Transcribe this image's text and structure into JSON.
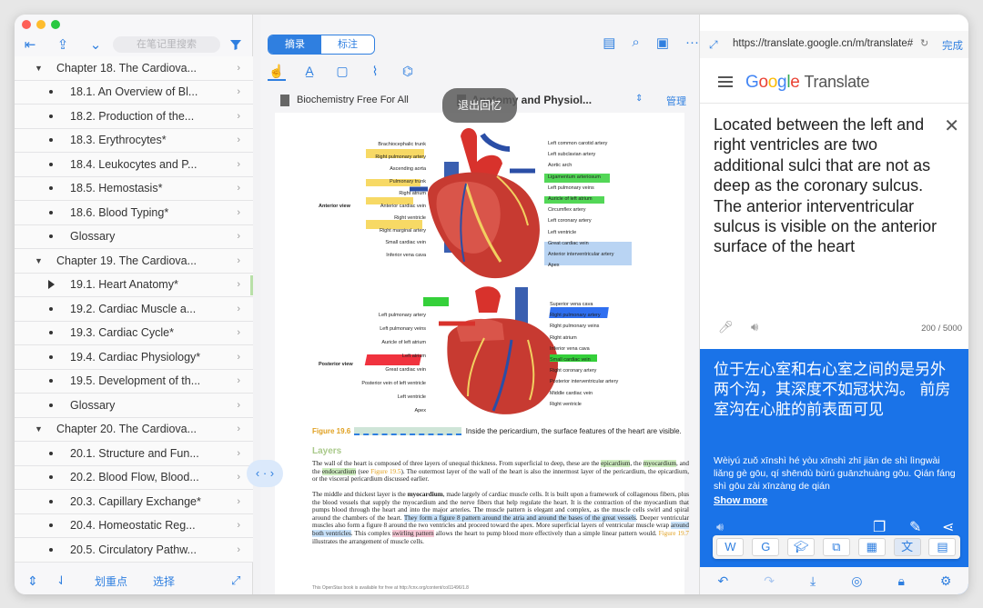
{
  "window": {
    "traffic_colors": [
      "#fe5f57",
      "#febc2e",
      "#28c840"
    ]
  },
  "left_panel": {
    "note_search_placeholder": "在笔记里搜索",
    "toc": [
      {
        "kind": "chapter",
        "label": "Chapter 18. The Cardiova..."
      },
      {
        "kind": "section",
        "label": "18.1. An Overview of Bl..."
      },
      {
        "kind": "section",
        "label": "18.2. Production of the..."
      },
      {
        "kind": "section",
        "label": "18.3. Erythrocytes*"
      },
      {
        "kind": "section",
        "label": "18.4. Leukocytes and P..."
      },
      {
        "kind": "section",
        "label": "18.5. Hemostasis*"
      },
      {
        "kind": "section",
        "label": "18.6. Blood Typing*"
      },
      {
        "kind": "section",
        "label": "Glossary"
      },
      {
        "kind": "chapter",
        "label": "Chapter 19. The Cardiova..."
      },
      {
        "kind": "current",
        "label": "19.1. Heart Anatomy*"
      },
      {
        "kind": "section",
        "label": "19.2. Cardiac Muscle a..."
      },
      {
        "kind": "section",
        "label": "19.3. Cardiac Cycle*"
      },
      {
        "kind": "section",
        "label": "19.4. Cardiac Physiology*"
      },
      {
        "kind": "section",
        "label": "19.5. Development of th..."
      },
      {
        "kind": "section",
        "label": "Glossary"
      },
      {
        "kind": "chapter",
        "label": "Chapter 20. The Cardiova..."
      },
      {
        "kind": "section",
        "label": "20.1. Structure and Fun..."
      },
      {
        "kind": "section",
        "label": "20.2. Blood Flow, Blood..."
      },
      {
        "kind": "section",
        "label": "20.3. Capillary Exchange*"
      },
      {
        "kind": "section",
        "label": "20.4. Homeostatic Reg..."
      },
      {
        "kind": "section",
        "label": "20.5. Circulatory Pathw..."
      }
    ],
    "bottom": {
      "highlight_label": "划重点",
      "select_label": "选择"
    }
  },
  "middle_panel": {
    "tabs": {
      "excerpt": "摘录",
      "annotate": "标注"
    },
    "doc_left": "Biochemistry Free For All",
    "doc_right": "Anatomy and Physiol...",
    "manage": "管理",
    "tooltip": "退出回忆",
    "figure": {
      "anterior_title": "Anterior view",
      "posterior_title": "Posterior view",
      "anterior_left": [
        "Brachiocephalic trunk",
        "Right pulmonary artery",
        "Ascending aorta",
        "Pulmonary trunk",
        "Right atrium",
        "Anterior cardiac vein",
        "Right ventricle",
        "Right marginal artery",
        "Small cardiac vein",
        "Inferior vena cava"
      ],
      "anterior_right": [
        "Left common carotid artery",
        "Left subclavian artery",
        "Aortic arch",
        "Ligamentum arteriosum",
        "Left pulmonary veins",
        "Auricle of left atrium",
        "Circumflex artery",
        "Left coronary artery",
        "Left ventricle",
        "Great cardiac vein",
        "Anterior interventricular artery",
        "Apex"
      ],
      "posterior_left": [
        "Left pulmonary artery",
        "Left pulmonary veins",
        "Auricle of left atrium",
        "Left atrium",
        "Great cardiac vein",
        "Posterior vein of left ventricle",
        "Left ventricle",
        "Apex"
      ],
      "posterior_right": [
        "Superior vena cava",
        "Right pulmonary artery",
        "Right pulmonary veins",
        "Right atrium",
        "Inferior vena cava",
        "Small cardiac vein",
        "Right coronary artery",
        "Posterior interventricular artery",
        "Middle cardiac vein",
        "Right ventricle"
      ]
    },
    "caption_prefix": "Figure 19.6",
    "caption_text": "Inside the pericardium, the surface features of the heart are visible.",
    "section_title": "Layers",
    "para1": {
      "a": "The wall of the heart is composed of three layers of unequal thickness. From superficial to deep, these are the ",
      "epicardium": "epicardium",
      "b": ", the ",
      "myocardium": "myocardium",
      "c": ", and the ",
      "endocardium": "endocardium",
      "d": " (see ",
      "fig": "Figure 19.5",
      "e": "). The outermost layer of the wall of the heart is also the innermost layer of the pericardium, the epicardium, or the visceral pericardium discussed earlier."
    },
    "para2": {
      "a": "The middle and thickest layer is the ",
      "myo": "myocardium",
      "b": ", made largely of cardiac muscle cells. It is built upon a framework of collagenous fibers, plus the blood vessels that supply the myocardium and the nerve fibers that help regulate the heart. It is the contraction of the myocardium that pumps blood through the heart and into the major arteries. The muscle pattern is elegant and complex, as the muscle cells swirl and spiral around the chambers of the heart. ",
      "hl1": "They form a figure 8 pattern around the atria and around the bases of the great vessels",
      "c": ". Deeper ventricular muscles also form a figure 8 around the two ventricles and proceed toward the apex. More superficial layers of ventricular muscle wrap ",
      "hl2": "around both ventricles",
      "d": ". This complex ",
      "hl3": "swirling pattern",
      "e": " allows the heart to pump blood more effectively than a simple linear pattern would. ",
      "fig": "Figure 19.7",
      "f": " illustrates the arrangement of muscle cells."
    },
    "footer": "This OpenStax book is available for free at http://cnx.org/content/col11496/1.8"
  },
  "right_panel": {
    "url": "https://translate.google.cn/m/translate#",
    "done": "完成",
    "logo_word": "Google",
    "logo_colors": [
      "#4285F4",
      "#EA4335",
      "#FBBC05",
      "#4285F4",
      "#34A853",
      "#EA4335"
    ],
    "logo_suffix": "Translate",
    "source_text": "Located between the left and right ventricles are two additional sulci that are not as deep as the coronary sulcus. The anterior interventricular sulcus is visible on the anterior surface of the heart",
    "char_count": "200 / 5000",
    "target_text": "位于左心室和右心室之间的是另外两个沟，其深度不如冠状沟。 前房室沟在心脏的前表面可见",
    "pinyin": "Wèiyú zuǒ xīnshì hé yòu xīnshì zhī jiān de shì lìngwài liǎng gè gōu, qí shēndù bùrú guānzhuàng gōu. Qián fáng shì gōu zài xīnzàng de qián",
    "show_more": "Show more"
  }
}
